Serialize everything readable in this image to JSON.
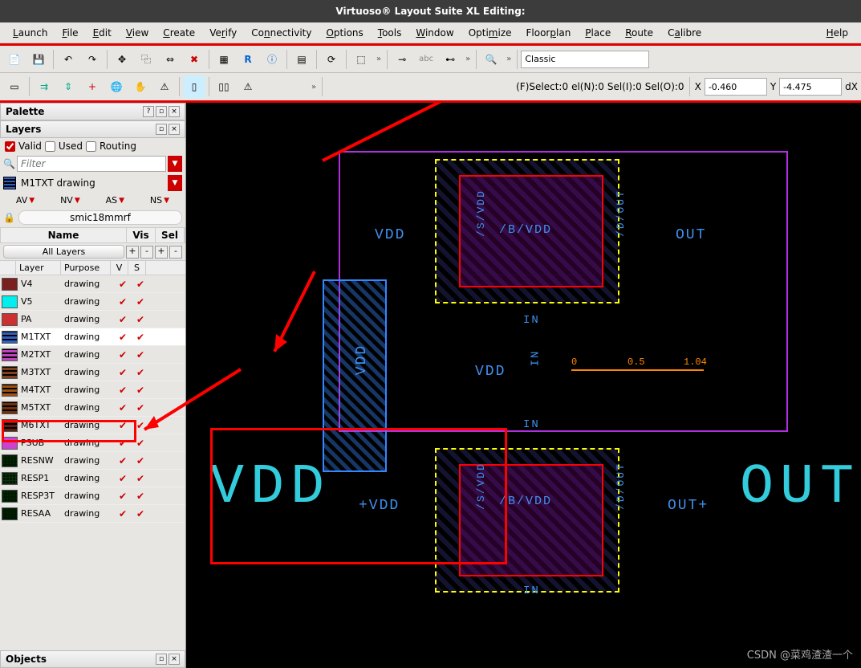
{
  "title": "Virtuoso® Layout Suite XL Editing:",
  "menu": [
    "Launch",
    "File",
    "Edit",
    "View",
    "Create",
    "Verify",
    "Connectivity",
    "Options",
    "Tools",
    "Window",
    "Optimize",
    "Floorplan",
    "Place",
    "Route",
    "Calibre",
    "Help"
  ],
  "toolbar1_classic": "Classic",
  "status": {
    "fselect": "(F)Select:0",
    "seln": "el(N):0",
    "seli": "Sel(I):0",
    "selo": "Sel(O):0",
    "x_label": "X",
    "x_val": "-0.460",
    "y_label": "Y",
    "y_val": "-4.475",
    "dx_label": "dX"
  },
  "palette": {
    "title": "Palette",
    "layers_title": "Layers",
    "valid": "Valid",
    "used": "Used",
    "routing": "Routing",
    "filter_placeholder": "Filter",
    "current_layer": "M1TXT drawing",
    "vis_buttons": [
      "AV",
      "NV",
      "AS",
      "NS"
    ],
    "tech": "smic18mmrf",
    "name_hdr": "Name",
    "vis_hdr": "Vis",
    "sel_hdr": "Sel",
    "all_layers": "All Layers",
    "table_hdr": {
      "layer": "Layer",
      "purpose": "Purpose",
      "v": "V",
      "s": "S"
    },
    "layers": [
      {
        "name": "V4",
        "purpose": "drawing",
        "color": "#7a2020",
        "pattern": ""
      },
      {
        "name": "V5",
        "purpose": "drawing",
        "color": "#00eeee",
        "pattern": ""
      },
      {
        "name": "PA",
        "purpose": "drawing",
        "color": "#cc3030",
        "pattern": ""
      },
      {
        "name": "M1TXT",
        "purpose": "drawing",
        "color": "#3060c0",
        "pattern": "brick",
        "sel": true
      },
      {
        "name": "M2TXT",
        "purpose": "drawing",
        "color": "#c040c0",
        "pattern": "brick"
      },
      {
        "name": "M3TXT",
        "purpose": "drawing",
        "color": "#804020",
        "pattern": "brick"
      },
      {
        "name": "M4TXT",
        "purpose": "drawing",
        "color": "#a05010",
        "pattern": "brick"
      },
      {
        "name": "M5TXT",
        "purpose": "drawing",
        "color": "#703010",
        "pattern": "brick"
      },
      {
        "name": "M6TXT",
        "purpose": "drawing",
        "color": "#602010",
        "pattern": "brick"
      },
      {
        "name": "PSUB",
        "purpose": "drawing",
        "color": "#d040d0",
        "pattern": ""
      },
      {
        "name": "RESNW",
        "purpose": "drawing",
        "color": "#003000",
        "pattern": "dots"
      },
      {
        "name": "RESP1",
        "purpose": "drawing",
        "color": "#103010",
        "pattern": "grid"
      },
      {
        "name": "RESP3T",
        "purpose": "drawing",
        "color": "#003000",
        "pattern": "dots"
      },
      {
        "name": "RESAA",
        "purpose": "drawing",
        "color": "#002000",
        "pattern": "dots"
      }
    ],
    "objects_title": "Objects"
  },
  "canvas_labels": {
    "vdd_top": "VDD",
    "svdd": "/S/VDD",
    "bvdd": "/B/VDD",
    "dout": "/D/OUT",
    "out": "OUT",
    "vdd_mid": "VDD",
    "in": "IN",
    "vdd_left": "VDD",
    "vdd_center": "VDD",
    "in_rot": "IN",
    "plus_vdd": "+VDD",
    "plus_out": "OUT+",
    "big_vdd": "VDD",
    "big_out": "OUT",
    "ruler0": "0",
    "ruler05": "0.5",
    "ruler1": "1.04"
  },
  "watermark": "CSDN @菜鸡渣渣一个"
}
